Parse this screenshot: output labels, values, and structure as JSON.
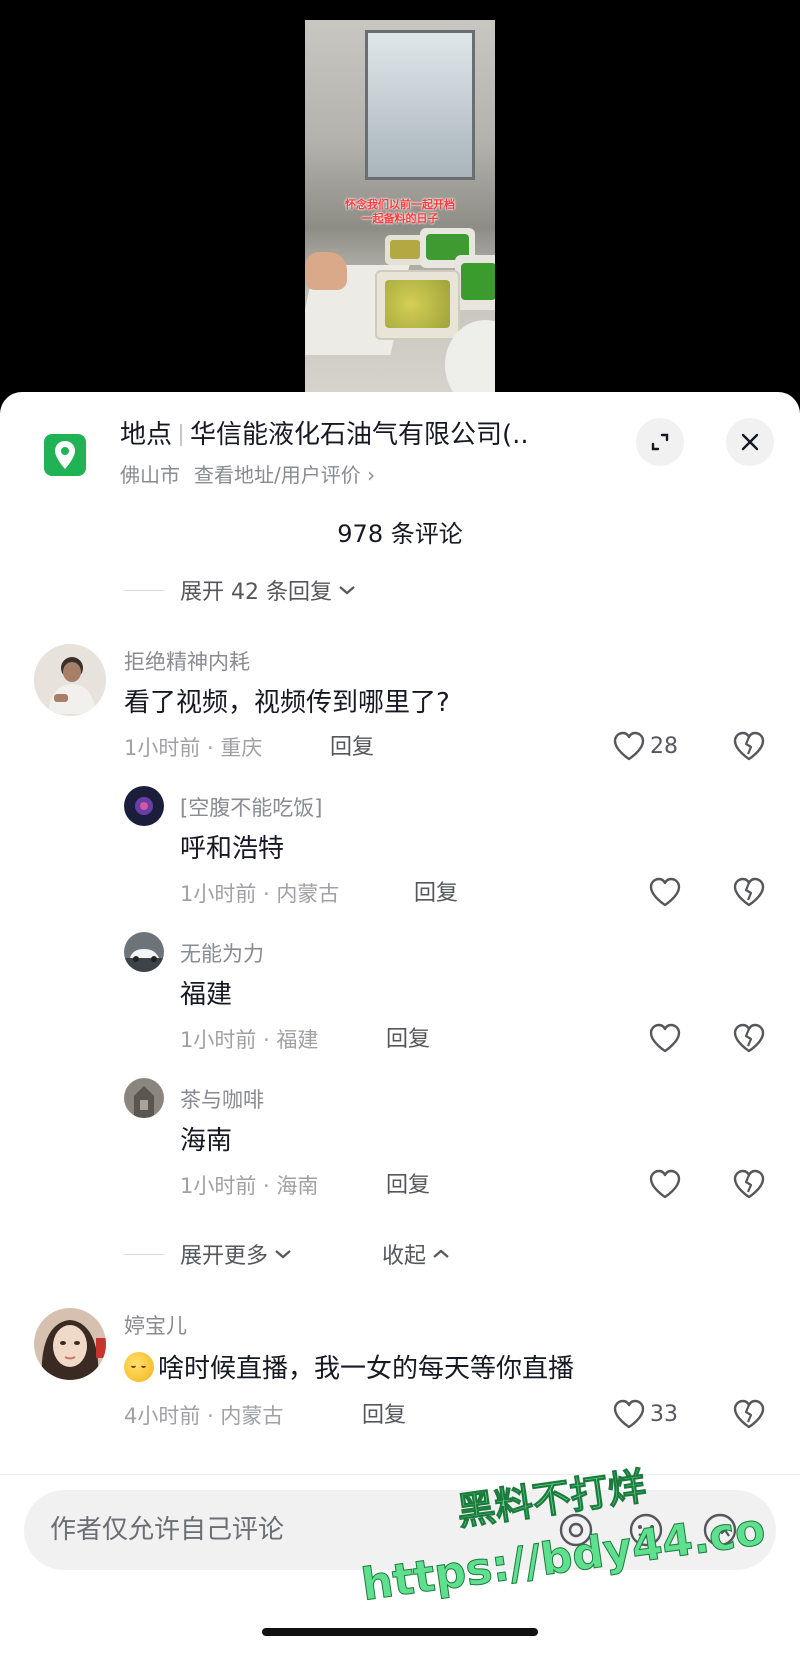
{
  "video": {
    "caption_line1": "怀念我们以前一起开档",
    "caption_line2": "一起备料的日子"
  },
  "location": {
    "label": "地点",
    "name": "华信能液化石油气有限公司(..",
    "city": "佛山市",
    "link": "查看地址/用户评价",
    "link_chevron": "›"
  },
  "comments_header": {
    "count_text": "978 条评论"
  },
  "top_expand": {
    "label": "展开 42 条回复",
    "chevron": "⌄"
  },
  "comments": [
    {
      "user": "拒绝精神内耗",
      "text": "看了视频，视频传到哪里了?",
      "meta": "1小时前 · 重庆",
      "reply": "回复",
      "likes": "28"
    },
    {
      "user": "婷宝儿",
      "text": "啥时候直播，我一女的每天等你直播",
      "meta": "4小时前 · 内蒙古",
      "reply": "回复",
      "likes": "33"
    }
  ],
  "replies": [
    {
      "user": "[空腹不能吃饭]",
      "text": "呼和浩特",
      "meta": "1小时前 · 内蒙古",
      "reply": "回复"
    },
    {
      "user": "无能为力",
      "text": "福建",
      "meta": "1小时前 · 福建",
      "reply": "回复"
    },
    {
      "user": "茶与咖啡",
      "text": "海南",
      "meta": "1小时前 · 海南",
      "reply": "回复"
    }
  ],
  "replies_footer": {
    "expand_more": "展开更多",
    "collapse": "收起"
  },
  "input": {
    "placeholder": "作者仅允许自己评论"
  },
  "watermark": {
    "line1": "黑料不打烊",
    "line2": "https://bdy44.co"
  },
  "colors": {
    "location_green": "#1fb356",
    "watermark_green": "#5fe08e"
  },
  "icons": {
    "location": "map-pin-icon",
    "expand": "expand-icon",
    "close": "close-icon",
    "like": "heart-icon",
    "dislike": "broken-heart-icon"
  }
}
